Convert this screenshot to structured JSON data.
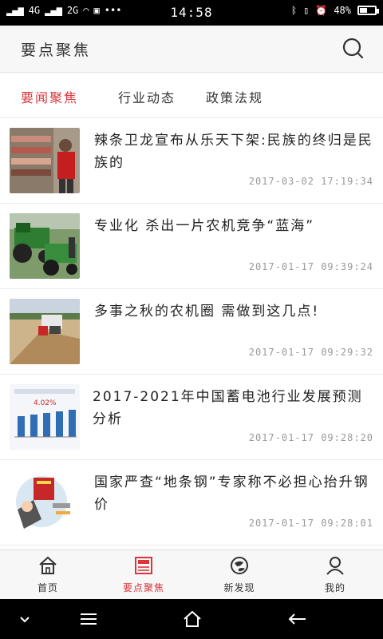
{
  "status_bar": {
    "network_left": "4G",
    "network_right": "2G",
    "time": "14:58",
    "battery_percent": "48%",
    "battery_level": 0.48
  },
  "header": {
    "title": "要点聚焦",
    "search_icon": "search-icon"
  },
  "tabs": [
    {
      "label": "要闻聚焦",
      "active": true
    },
    {
      "label": "行业动态",
      "active": false
    },
    {
      "label": "政策法规",
      "active": false
    }
  ],
  "articles": [
    {
      "title": "辣条卫龙宣布从乐天下架:民族的终归是民族的",
      "time": "2017-03-02 17:19:34"
    },
    {
      "title": "专业化 杀出一片农机竞争“蓝海”",
      "time": "2017-01-17 09:39:24"
    },
    {
      "title": "多事之秋的农机圈 需做到这几点!",
      "time": "2017-01-17 09:29:32"
    },
    {
      "title": "2017-2021年中国蓄电池行业发展预测分析",
      "time": "2017-01-17 09:28:20",
      "thumb_badge": "4.02%"
    },
    {
      "title": "国家严查“地条钢”专家称不必担心抬升钢价",
      "time": "2017-01-17 09:28:01"
    }
  ],
  "bottom_nav": [
    {
      "label": "首页",
      "icon": "home-icon",
      "active": false
    },
    {
      "label": "要点聚焦",
      "icon": "newspaper-icon",
      "active": true
    },
    {
      "label": "新发现",
      "icon": "discover-icon",
      "active": false
    },
    {
      "label": "我的",
      "icon": "user-icon",
      "active": false
    }
  ],
  "colors": {
    "accent": "#d9363e",
    "text": "#222222",
    "muted": "#9a9a9a"
  }
}
